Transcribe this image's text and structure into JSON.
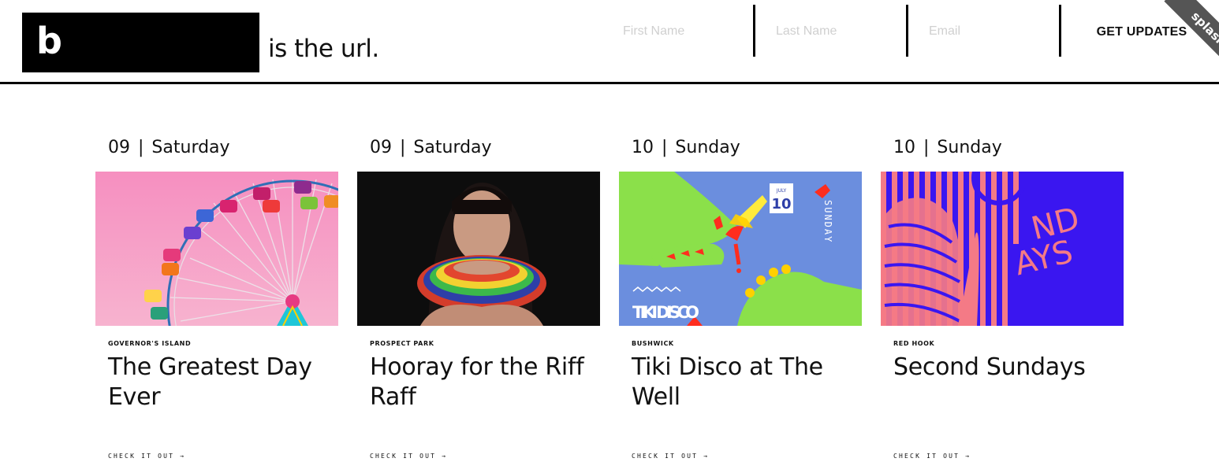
{
  "header": {
    "logo_letter": "b",
    "tagline": "is the url.",
    "signup": {
      "first_name_placeholder": "First Name",
      "last_name_placeholder": "Last Name",
      "email_placeholder": "Email",
      "button_label": "GET UPDATES"
    },
    "ribbon_label": "splash"
  },
  "events": [
    {
      "day_num": "09",
      "separator": "|",
      "weekday": "Saturday",
      "location": "GOVERNOR'S ISLAND",
      "title": "The Greatest Day Ever",
      "cta": "CHECK IT OUT →",
      "image_subject": "ferris-wheel"
    },
    {
      "day_num": "09",
      "separator": "|",
      "weekday": "Saturday",
      "location": "PROSPECT PARK",
      "title": "Hooray for the Riff Raff",
      "cta": "CHECK IT OUT →",
      "image_subject": "portrait"
    },
    {
      "day_num": "10",
      "separator": "|",
      "weekday": "Sunday",
      "location": "BUSHWICK",
      "title": "Tiki Disco at The Well",
      "cta": "CHECK IT OUT →",
      "image_subject": "tiki-disco-poster",
      "poster_text": {
        "month": "JULY",
        "day": "10",
        "vertical": "SUNDAY",
        "name": "TIKI DISCO"
      }
    },
    {
      "day_num": "10",
      "separator": "|",
      "weekday": "Sunday",
      "location": "RED HOOK",
      "title": "Second Sundays",
      "cta": "CHECK IT OUT →",
      "image_subject": "second-sundays-graphic",
      "poster_text": {
        "line1": "ND",
        "line2": "AYS"
      }
    }
  ],
  "colors": {
    "pink_sky": "#f79bc6",
    "wheel_blue": "#2f6fb6",
    "tiki_blue": "#6b8ede",
    "tiki_green": "#8be04a",
    "tiki_red": "#ff2d1e",
    "sundays_violet": "#3a16f0",
    "sundays_salmon": "#f47a86"
  }
}
